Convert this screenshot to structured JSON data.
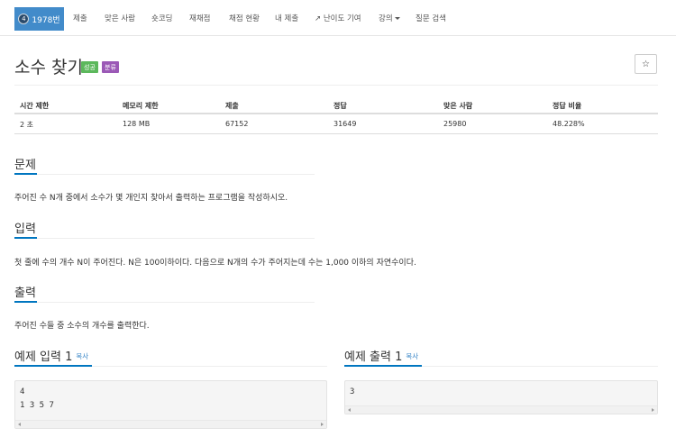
{
  "nav": {
    "problem_number": "1978번",
    "tier_badge": "4",
    "items": [
      "제출",
      "맞은 사람",
      "숏코딩",
      "재채점",
      "채점 현황",
      "내 제출",
      "난이도 기여",
      "강의",
      "질문 검색"
    ]
  },
  "problem": {
    "title": "소수 찾기",
    "label_success": "성공",
    "label_class": "분류"
  },
  "info_table": {
    "headers": [
      "시간 제한",
      "메모리 제한",
      "제출",
      "정답",
      "맞은 사람",
      "정답 비율"
    ],
    "row": [
      "2 초",
      "128 MB",
      "67152",
      "31649",
      "25980",
      "48.228%"
    ]
  },
  "sections": {
    "description_title": "문제",
    "description_text": "주어진 수 N개 중에서 소수가 몇 개인지 찾아서 출력하는 프로그램을 작성하시오.",
    "input_title": "입력",
    "input_text": "첫 줄에 수의 개수 N이 주어진다. N은 100이하이다. 다음으로 N개의 수가 주어지는데 수는 1,000 이하의 자연수이다.",
    "output_title": "출력",
    "output_text": "주어진 수들 중 소수의 개수를 출력한다."
  },
  "samples": {
    "input_title": "예제 입력 1",
    "output_title": "예제 출력 1",
    "copy_label": "복사",
    "input_text": "4\n1 3 5 7",
    "output_text": "3"
  },
  "colors": {
    "primary": "#428bca",
    "success": "#5cb85c",
    "class_label": "#9b59b6",
    "section_accent": "#0076c0"
  }
}
